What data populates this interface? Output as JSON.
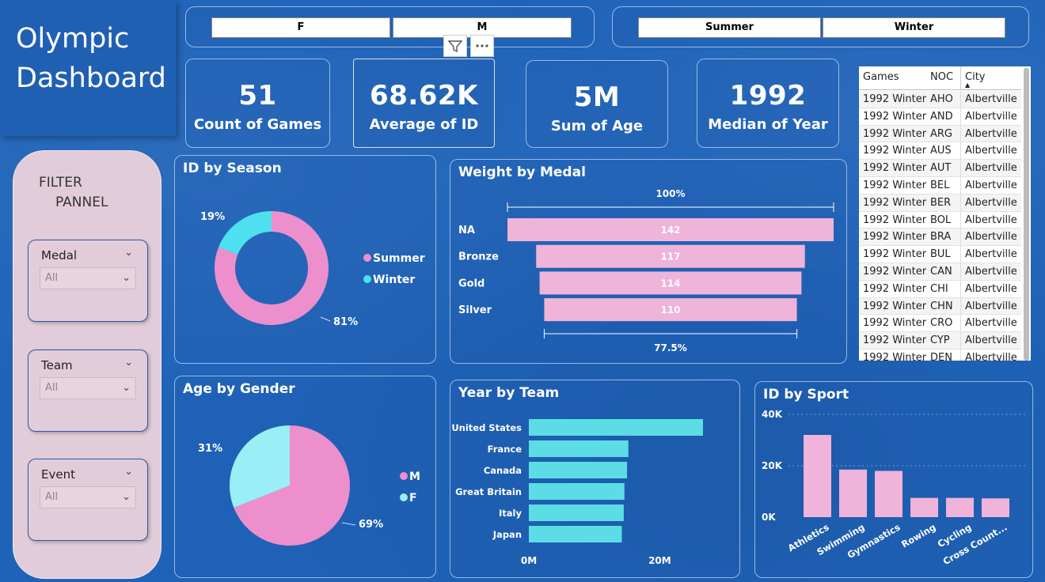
{
  "title": {
    "line1": "Olympic",
    "line2": "Dashboard"
  },
  "gender_slicer": {
    "options": [
      "F",
      "M"
    ]
  },
  "season_slicer": {
    "options": [
      "Summer",
      "Winter"
    ]
  },
  "kpis": [
    {
      "value": "51",
      "label": "Count of Games"
    },
    {
      "value": "68.62K",
      "label": "Average of ID"
    },
    {
      "value": "5M",
      "label": "Sum of Age"
    },
    {
      "value": "1992",
      "label": "Median of Year"
    }
  ],
  "filter_panel": {
    "title_line1": "FILTER",
    "title_line2": "PANNEL",
    "filters": [
      {
        "label": "Medal",
        "value": "All"
      },
      {
        "label": "Team",
        "value": "All"
      },
      {
        "label": "Event",
        "value": "All"
      }
    ]
  },
  "table": {
    "columns": [
      "Games",
      "NOC",
      "City"
    ],
    "rows": [
      [
        "1992 Winter",
        "AHO",
        "Albertville"
      ],
      [
        "1992 Winter",
        "AND",
        "Albertville"
      ],
      [
        "1992 Winter",
        "ARG",
        "Albertville"
      ],
      [
        "1992 Winter",
        "AUS",
        "Albertville"
      ],
      [
        "1992 Winter",
        "AUT",
        "Albertville"
      ],
      [
        "1992 Winter",
        "BEL",
        "Albertville"
      ],
      [
        "1992 Winter",
        "BER",
        "Albertville"
      ],
      [
        "1992 Winter",
        "BOL",
        "Albertville"
      ],
      [
        "1992 Winter",
        "BRA",
        "Albertville"
      ],
      [
        "1992 Winter",
        "BUL",
        "Albertville"
      ],
      [
        "1992 Winter",
        "CAN",
        "Albertville"
      ],
      [
        "1992 Winter",
        "CHI",
        "Albertville"
      ],
      [
        "1992 Winter",
        "CHN",
        "Albertville"
      ],
      [
        "1992 Winter",
        "CRO",
        "Albertville"
      ],
      [
        "1992 Winter",
        "CYP",
        "Albertville"
      ],
      [
        "1992 Winter",
        "DEN",
        "Albertville"
      ]
    ]
  },
  "colors": {
    "pink": "#f0b3d9",
    "pink_dark": "#ed8fcd",
    "cyan": "#5ce0e8",
    "cyan_light": "#9aeef5"
  },
  "icons": {
    "filter": "filter-icon",
    "more": "more-options-icon",
    "chevron": "chevron-down-icon",
    "sort": "sort-ascending-icon"
  },
  "chart_data": [
    {
      "id": "season",
      "type": "pie",
      "variant": "donut",
      "title": "ID by Season",
      "categories": [
        "Summer",
        "Winter"
      ],
      "values": [
        81,
        19
      ],
      "labels": [
        "81%",
        "19%"
      ],
      "colors": [
        "#ed8fcd",
        "#4ee0ee"
      ],
      "legend": "right"
    },
    {
      "id": "medal",
      "type": "bar",
      "variant": "funnel",
      "title": "Weight by Medal",
      "categories": [
        "NA",
        "Bronze",
        "Gold",
        "Silver"
      ],
      "values": [
        142,
        117,
        114,
        110
      ],
      "top_label": "100%",
      "bottom_label": "77.5%"
    },
    {
      "id": "gender",
      "type": "pie",
      "title": "Age by Gender",
      "categories": [
        "M",
        "F"
      ],
      "values": [
        69,
        31
      ],
      "labels": [
        "69%",
        "31%"
      ],
      "colors": [
        "#ed8fcd",
        "#9aeef5"
      ],
      "legend": "right"
    },
    {
      "id": "team",
      "type": "bar",
      "orientation": "horizontal",
      "title": "Year by Team",
      "categories": [
        "United States",
        "France",
        "Canada",
        "Great Britain",
        "Italy",
        "Japan"
      ],
      "values": [
        26.6,
        15.2,
        15.0,
        14.6,
        14.5,
        14.2
      ],
      "xlim": [
        0,
        27
      ],
      "x_ticks": [
        "0M",
        "20M"
      ],
      "x_tick_values": [
        0,
        20
      ]
    },
    {
      "id": "sport",
      "type": "bar",
      "title": "ID by Sport",
      "categories": [
        "Athletics",
        "Swimming",
        "Gymnastics",
        "Rowing",
        "Cycling",
        "Cross Count..."
      ],
      "values": [
        32000,
        18500,
        18000,
        7500,
        7500,
        7300
      ],
      "ylim": [
        0,
        40000
      ],
      "y_ticks": [
        "0K",
        "20K",
        "40K"
      ],
      "y_tick_values": [
        0,
        20000,
        40000
      ],
      "grid": true
    }
  ]
}
